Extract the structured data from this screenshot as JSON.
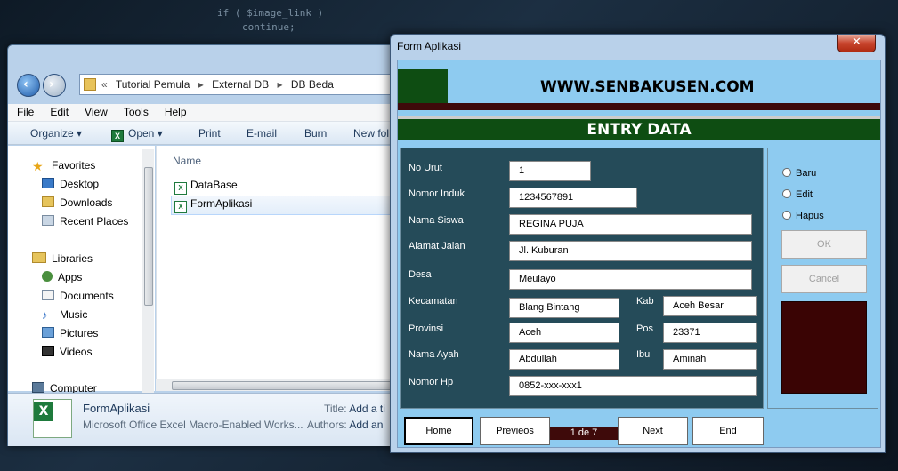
{
  "background_code": [
    "if ( $image_link )",
    "continue;"
  ],
  "explorer": {
    "breadcrumb": [
      "Tutorial Pemula",
      "External DB",
      "DB Beda"
    ],
    "menu": [
      "File",
      "Edit",
      "View",
      "Tools",
      "Help"
    ],
    "toolbar": {
      "organize": "Organize ▾",
      "open": "Open ▾",
      "print": "Print",
      "email": "E-mail",
      "burn": "Burn",
      "new_folder": "New fol"
    },
    "nav": {
      "favorites": "Favorites",
      "favorites_items": [
        "Desktop",
        "Downloads",
        "Recent Places"
      ],
      "libraries": "Libraries",
      "libraries_items": [
        "Apps",
        "Documents",
        "Music",
        "Pictures",
        "Videos"
      ],
      "computer": "Computer"
    },
    "column_name": "Name",
    "files": [
      "DataBase",
      "FormAplikasi"
    ],
    "details": {
      "name": "FormAplikasi",
      "type": "Microsoft Office Excel Macro-Enabled Works...",
      "title_label": "Title:",
      "title_value": "Add a ti",
      "authors_label": "Authors:",
      "authors_value": "Add an"
    }
  },
  "form": {
    "window_title": "Form Aplikasi",
    "close": "✕",
    "banner": "WWW.SENBAKUSEN.COM",
    "entry": "ENTRY DATA",
    "fields": {
      "no_urut": {
        "label": "No Urut",
        "value": "1"
      },
      "nomor_induk": {
        "label": "Nomor Induk",
        "value": "1234567891"
      },
      "nama_siswa": {
        "label": "Nama Siswa",
        "value": "REGINA PUJA"
      },
      "alamat_jalan": {
        "label": "Alamat Jalan",
        "value": "Jl. Kuburan"
      },
      "desa": {
        "label": "Desa",
        "value": "Meulayo"
      },
      "kecamatan": {
        "label": "Kecamatan",
        "value": "Blang Bintang"
      },
      "kab": {
        "label": "Kab",
        "value": "Aceh Besar"
      },
      "provinsi": {
        "label": "Provinsi",
        "value": "Aceh"
      },
      "pos": {
        "label": "Pos",
        "value": "23371"
      },
      "nama_ayah": {
        "label": "Nama Ayah",
        "value": "Abdullah"
      },
      "ibu": {
        "label": "Ibu",
        "value": "Aminah"
      },
      "nomor_hp": {
        "label": "Nomor Hp",
        "value": "0852-xxx-xxx1"
      }
    },
    "radios": [
      "Baru",
      "Edit",
      "Hapus"
    ],
    "ok": "OK",
    "cancel": "Cancel",
    "nav_buttons": {
      "home": "Home",
      "previous": "Previeos",
      "next": "Next",
      "end": "End"
    },
    "page_indicator": "1 de 7"
  }
}
